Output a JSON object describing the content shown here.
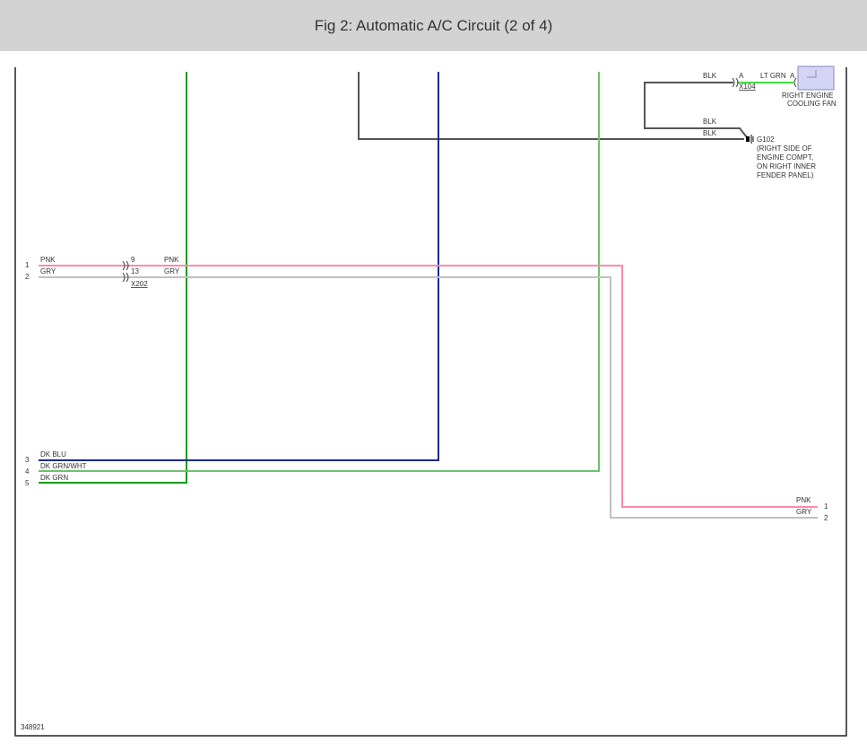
{
  "header": {
    "title": "Fig 2: Automatic A/C Circuit (2 of 4)"
  },
  "diagram_id": "348921",
  "colors": {
    "pnk": "#ff88aa",
    "gry": "#c0c0c0",
    "dk_grn": "#1a9a1a",
    "dk_blu": "#1a2a8a",
    "dk_grn_wht": "#6cc26c",
    "lt_grn": "#44dd44",
    "blk": "#555555"
  },
  "left_pins": [
    {
      "num": "1",
      "wire": "PNK"
    },
    {
      "num": "2",
      "wire": "GRY"
    },
    {
      "num": "3",
      "wire": "DK BLU"
    },
    {
      "num": "4",
      "wire": "DK GRN/WHT"
    },
    {
      "num": "5",
      "wire": "DK GRN"
    }
  ],
  "x202": {
    "name": "X202",
    "pins": [
      "9",
      "13"
    ],
    "wires_after": [
      "PNK",
      "GRY"
    ]
  },
  "right_pins": [
    {
      "num": "1",
      "wire": "PNK"
    },
    {
      "num": "2",
      "wire": "GRY"
    }
  ],
  "x104": {
    "name": "X104",
    "pin": "A",
    "wire_in": "BLK",
    "wire_out": "LT GRN"
  },
  "fan": {
    "pin": "A",
    "label1": "RIGHT ENGINE",
    "label2": "COOLING FAN"
  },
  "ground": {
    "wire1": "BLK",
    "wire2": "BLK",
    "name": "G102",
    "loc": [
      "(RIGHT SIDE OF",
      "ENGINE COMPT,",
      "ON RIGHT INNER",
      "FENDER PANEL)"
    ]
  }
}
